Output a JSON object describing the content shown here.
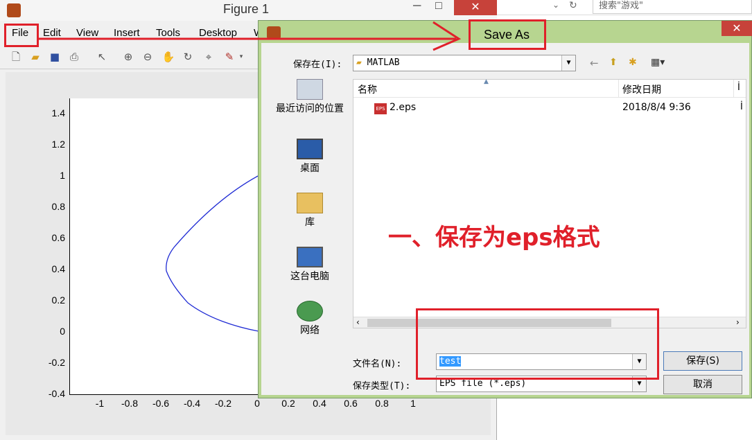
{
  "figure": {
    "title": "Figure 1",
    "menu": [
      "File",
      "Edit",
      "View",
      "Insert",
      "Tools",
      "Desktop",
      "W"
    ],
    "axes": {
      "yticks": [
        "1.4",
        "1.2",
        "1",
        "0.8",
        "0.6",
        "0.4",
        "0.2",
        "0",
        "-0.2",
        "-0.4"
      ],
      "xticks": [
        "-1",
        "-0.8",
        "-0.6",
        "-0.4",
        "-0.2",
        "0",
        "0.2",
        "0.4",
        "0.6",
        "0.8",
        "1"
      ]
    }
  },
  "browser": {
    "search_placeholder": "搜索\"游戏\""
  },
  "dialog": {
    "title": "Save As",
    "save_in_label": "保存在(I):",
    "save_in_value": "MATLAB",
    "places": [
      "最近访问的位置",
      "桌面",
      "库",
      "这台电脑",
      "网络"
    ],
    "columns": [
      "名称",
      "修改日期",
      "İ"
    ],
    "files": [
      {
        "name": "2.eps",
        "modified": "2018/8/4 9:36",
        "extra": "İ"
      }
    ],
    "filename_label": "文件名(N):",
    "filename_value": "test",
    "filetype_label": "保存类型(T):",
    "filetype_value": "EPS file (*.eps)",
    "save_button": "保存(S)",
    "cancel_button": "取消"
  },
  "annotation": {
    "text": "一、保存为eps格式",
    "color": "#e0202a"
  },
  "colors": {
    "accent_red": "#e0202a",
    "dialog_frame": "#b7d590",
    "curve": "#1f2bd4"
  }
}
